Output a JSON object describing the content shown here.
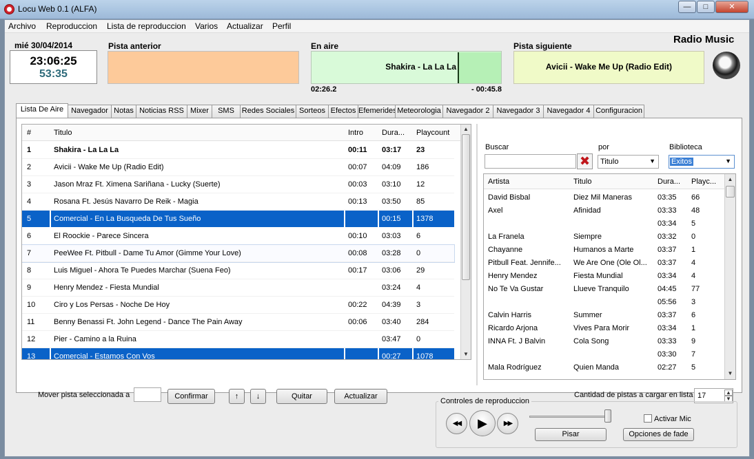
{
  "window": {
    "title": "Locu Web 0.1 (ALFA)"
  },
  "menu": [
    "Archivo",
    "Reproduccion",
    "Lista de reproduccion",
    "Varios",
    "Actualizar",
    "Perfil"
  ],
  "header": {
    "date": "mié 30/04/2014",
    "time": "23:06:25",
    "countdown": "53:35",
    "prev_label": "Pista anterior",
    "prev_track": "",
    "air_label": "En aire",
    "air_track": "Shakira - La La La",
    "air_elapsed": "02:26.2",
    "air_remaining": "- 00:45.8",
    "air_progress": 0.77,
    "next_label": "Pista siguiente",
    "next_track": "Avicii - Wake Me Up (Radio Edit)",
    "station": "Radio Music",
    "colors": {
      "prev": "#fdca9a",
      "air": "#d9fad9",
      "next": "#f0fac8",
      "selection": "#0a62c8"
    }
  },
  "tabs": [
    "Lista De Aire",
    "Navegador",
    "Notas",
    "Noticias RSS",
    "Mixer",
    "SMS",
    "Redes Sociales",
    "Sorteos",
    "Efectos",
    "Efemerides",
    "Meteorologia",
    "Navegador 2",
    "Navegador 3",
    "Navegador 4",
    "Configuracion"
  ],
  "playlist": {
    "columns": [
      "#",
      "Titulo",
      "Intro",
      "Dura...",
      "Playcount"
    ],
    "rows": [
      {
        "n": "1",
        "title": "Shakira - La La La",
        "intro": "00:11",
        "dur": "03:17",
        "plays": "23",
        "style": "bold"
      },
      {
        "n": "2",
        "title": "Avicii - Wake Me Up (Radio Edit)",
        "intro": "00:07",
        "dur": "04:09",
        "plays": "186",
        "style": ""
      },
      {
        "n": "3",
        "title": "Jason Mraz Ft. Ximena Sariñana - Lucky (Suerte)",
        "intro": "00:03",
        "dur": "03:10",
        "plays": "12",
        "style": ""
      },
      {
        "n": "4",
        "title": "Rosana Ft. Jesús Navarro De Reik - Magia",
        "intro": "00:13",
        "dur": "03:50",
        "plays": "85",
        "style": ""
      },
      {
        "n": "5",
        "title": "Comercial - En La Busqueda De Tus Sueño",
        "intro": "",
        "dur": "00:15",
        "plays": "1378",
        "style": "sel"
      },
      {
        "n": "6",
        "title": "El Roockie - Parece Sincera",
        "intro": "00:10",
        "dur": "03:03",
        "plays": "6",
        "style": ""
      },
      {
        "n": "7",
        "title": "PeeWee Ft. Pitbull - Dame Tu Amor (Gimme Your Love)",
        "intro": "00:08",
        "dur": "03:28",
        "plays": "0",
        "style": "hover"
      },
      {
        "n": "8",
        "title": "Luis Miguel - Ahora Te Puedes Marchar (Suena Feo)",
        "intro": "00:17",
        "dur": "03:06",
        "plays": "29",
        "style": ""
      },
      {
        "n": "9",
        "title": "Henry Mendez - Fiesta Mundial",
        "intro": "",
        "dur": "03:24",
        "plays": "4",
        "style": ""
      },
      {
        "n": "10",
        "title": "Ciro y Los Persas - Noche De Hoy",
        "intro": "00:22",
        "dur": "04:39",
        "plays": "3",
        "style": ""
      },
      {
        "n": "11",
        "title": "Benny Benassi Ft. John Legend - Dance The Pain Away",
        "intro": "00:06",
        "dur": "03:40",
        "plays": "284",
        "style": ""
      },
      {
        "n": "12",
        "title": "Pier - Camino a la Ruina",
        "intro": "",
        "dur": "03:47",
        "plays": "0",
        "style": ""
      },
      {
        "n": "13",
        "title": "Comercial - Estamos Con Vos",
        "intro": "",
        "dur": "00:27",
        "plays": "1078",
        "style": "sel"
      }
    ]
  },
  "playlist_tools": {
    "move_label": "Mover pista seleccionada a",
    "move_value": "",
    "confirm": "Confirmar",
    "up": "↑",
    "down": "↓",
    "remove": "Quitar",
    "refresh": "Actualizar"
  },
  "library": {
    "search_label": "Buscar",
    "search_value": "",
    "by_label": "por",
    "by_value": "Titulo",
    "lib_label": "Biblioteca",
    "lib_value": "Exitos",
    "columns": [
      "Artista",
      "Titulo",
      "Dura...",
      "Playc..."
    ],
    "rows": [
      {
        "artist": "David Bisbal",
        "title": "Diez Mil Maneras",
        "dur": "03:35",
        "plays": "66"
      },
      {
        "artist": "Axel",
        "title": "Afinidad",
        "dur": "03:33",
        "plays": "48"
      },
      {
        "artist": "",
        "title": "",
        "dur": "03:34",
        "plays": "5"
      },
      {
        "artist": "La Franela",
        "title": "Siempre",
        "dur": "03:32",
        "plays": "0"
      },
      {
        "artist": "Chayanne",
        "title": "Humanos a Marte",
        "dur": "03:37",
        "plays": "1"
      },
      {
        "artist": "Pitbull Feat. Jennife...",
        "title": "We Are One (Ole Ol...",
        "dur": "03:37",
        "plays": "4"
      },
      {
        "artist": "Henry Mendez",
        "title": "Fiesta Mundial",
        "dur": "03:34",
        "plays": "4"
      },
      {
        "artist": "No Te Va Gustar",
        "title": "Llueve Tranquilo",
        "dur": "04:45",
        "plays": "77"
      },
      {
        "artist": "",
        "title": "",
        "dur": "05:56",
        "plays": "3"
      },
      {
        "artist": "Calvin Harris",
        "title": "Summer",
        "dur": "03:37",
        "plays": "6"
      },
      {
        "artist": "Ricardo Arjona",
        "title": "Vives Para Morir",
        "dur": "03:34",
        "plays": "1"
      },
      {
        "artist": "INNA Ft. J Balvin",
        "title": "Cola Song",
        "dur": "03:33",
        "plays": "9"
      },
      {
        "artist": "",
        "title": "",
        "dur": "03:30",
        "plays": "7"
      },
      {
        "artist": "Mala Rodríguez",
        "title": "Quien Manda",
        "dur": "02:27",
        "plays": "5"
      }
    ],
    "count_label": "Cantidad de pistas a cargar en lista",
    "count_value": "17"
  },
  "controls": {
    "group_label": "Controles de reproduccion",
    "rewind": "◀◀",
    "play": "▶",
    "forward": "▶▶",
    "mic_label": "Activar Mic",
    "mic_checked": false,
    "step": "Pisar",
    "fade": "Opciones de fade"
  }
}
